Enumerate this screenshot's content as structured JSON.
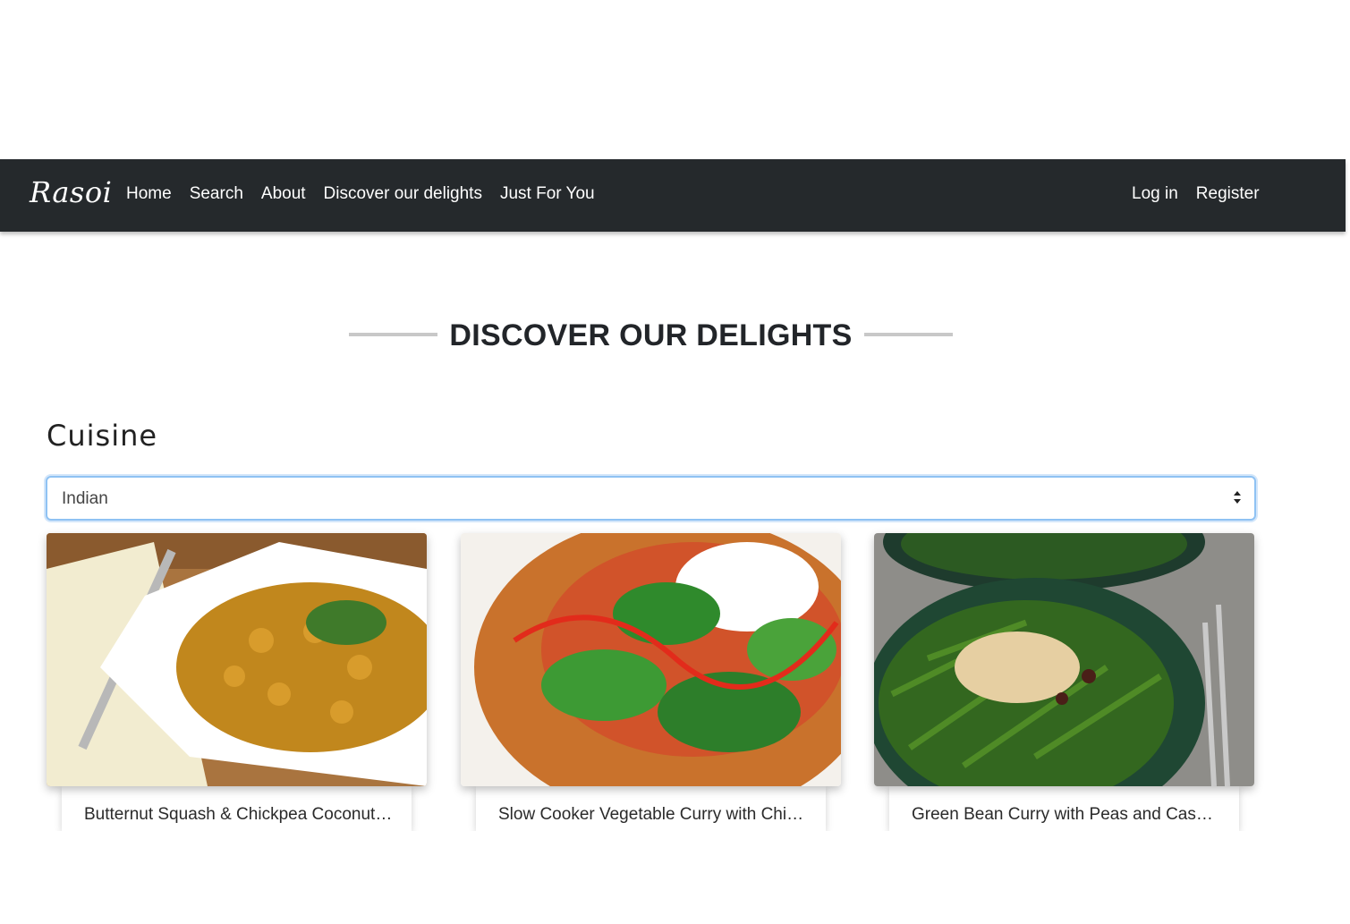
{
  "navbar": {
    "brand": "Rasoi",
    "links": [
      "Home",
      "Search",
      "About",
      "Discover our delights",
      "Just For You"
    ],
    "auth": [
      "Log in",
      "Register"
    ]
  },
  "main": {
    "heading": "DISCOVER OUR DELIGHTS",
    "cuisine_label": "Cuisine",
    "cuisine_select": {
      "selected": "Indian"
    },
    "recipes": [
      {
        "title": "Butternut Squash & Chickpea Coconut Curry"
      },
      {
        "title": "Slow Cooker Vegetable Curry with Chickpeas"
      },
      {
        "title": "Green Bean Curry with Peas and Cashews"
      }
    ]
  },
  "colors": {
    "navbar_bg": "#25292c",
    "heading_text": "#222529",
    "select_focus_border": "#8fc2f3"
  }
}
